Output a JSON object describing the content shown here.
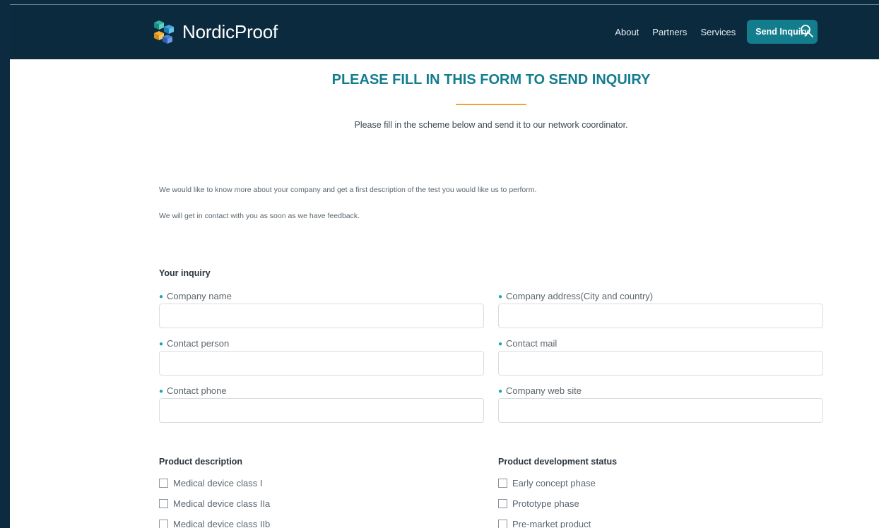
{
  "brand": {
    "name": "NordicProof"
  },
  "nav": {
    "items": [
      "About",
      "Partners",
      "Services"
    ],
    "cta": "Send Inquiry",
    "search_icon": "search-icon"
  },
  "page": {
    "title": "PLEASE FILL IN THIS FORM TO SEND INQUIRY",
    "subtitle": "Please fill in the scheme below and send it to our network coordinator.",
    "intro1": "We would like to know more about your company and get a first description of the test you would like us to perform.",
    "intro2": "We will get in contact with you as soon as we have feedback."
  },
  "form": {
    "section_title": "Your inquiry",
    "fields": {
      "company_name": {
        "label": "Company name",
        "value": ""
      },
      "company_address": {
        "label": "Company address(City and country)",
        "value": ""
      },
      "contact_person": {
        "label": "Contact person",
        "value": ""
      },
      "contact_mail": {
        "label": "Contact mail",
        "value": ""
      },
      "contact_phone": {
        "label": "Contact phone",
        "value": ""
      },
      "company_web": {
        "label": "Company web site",
        "value": ""
      }
    },
    "product_description": {
      "title": "Product description",
      "options": [
        "Medical device class I",
        "Medical device class IIa",
        "Medical device class IIb"
      ]
    },
    "development_status": {
      "title": "Product development status",
      "options": [
        "Early concept phase",
        "Prototype phase",
        "Pre-market product"
      ]
    }
  },
  "colors": {
    "navy": "#0b2a3e",
    "teal": "#137d8e",
    "accent": "#f0a53a"
  }
}
